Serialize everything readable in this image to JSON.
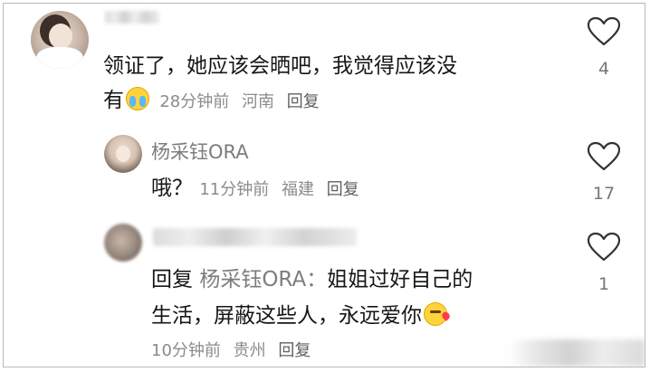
{
  "comments": [
    {
      "text_line1": "领证了，她应该会晒吧，我觉得应该没",
      "text_line2": "有",
      "emoji": "crying-face-emoji",
      "time": "28分钟前",
      "location": "河南",
      "reply_label": "回复",
      "likes": "4"
    },
    {
      "username": "杨采钰ORA",
      "text": "哦？",
      "time": "11分钟前",
      "location": "福建",
      "reply_label": "回复",
      "likes": "17"
    },
    {
      "reply_prefix": "回复",
      "reply_to": "杨采钰ORA：",
      "text_line1": "姐姐过好自己的",
      "text_line2": "生活，屏蔽这些人，永远爱你",
      "emoji": "kissing-face-emoji",
      "time": "10分钟前",
      "location": "贵州",
      "reply_label": "回复",
      "likes": "1"
    }
  ],
  "icons": {
    "like": "heart-outline-icon"
  },
  "colors": {
    "text": "#161616",
    "meta": "#8b8b8b",
    "username": "#7d7d7d"
  }
}
